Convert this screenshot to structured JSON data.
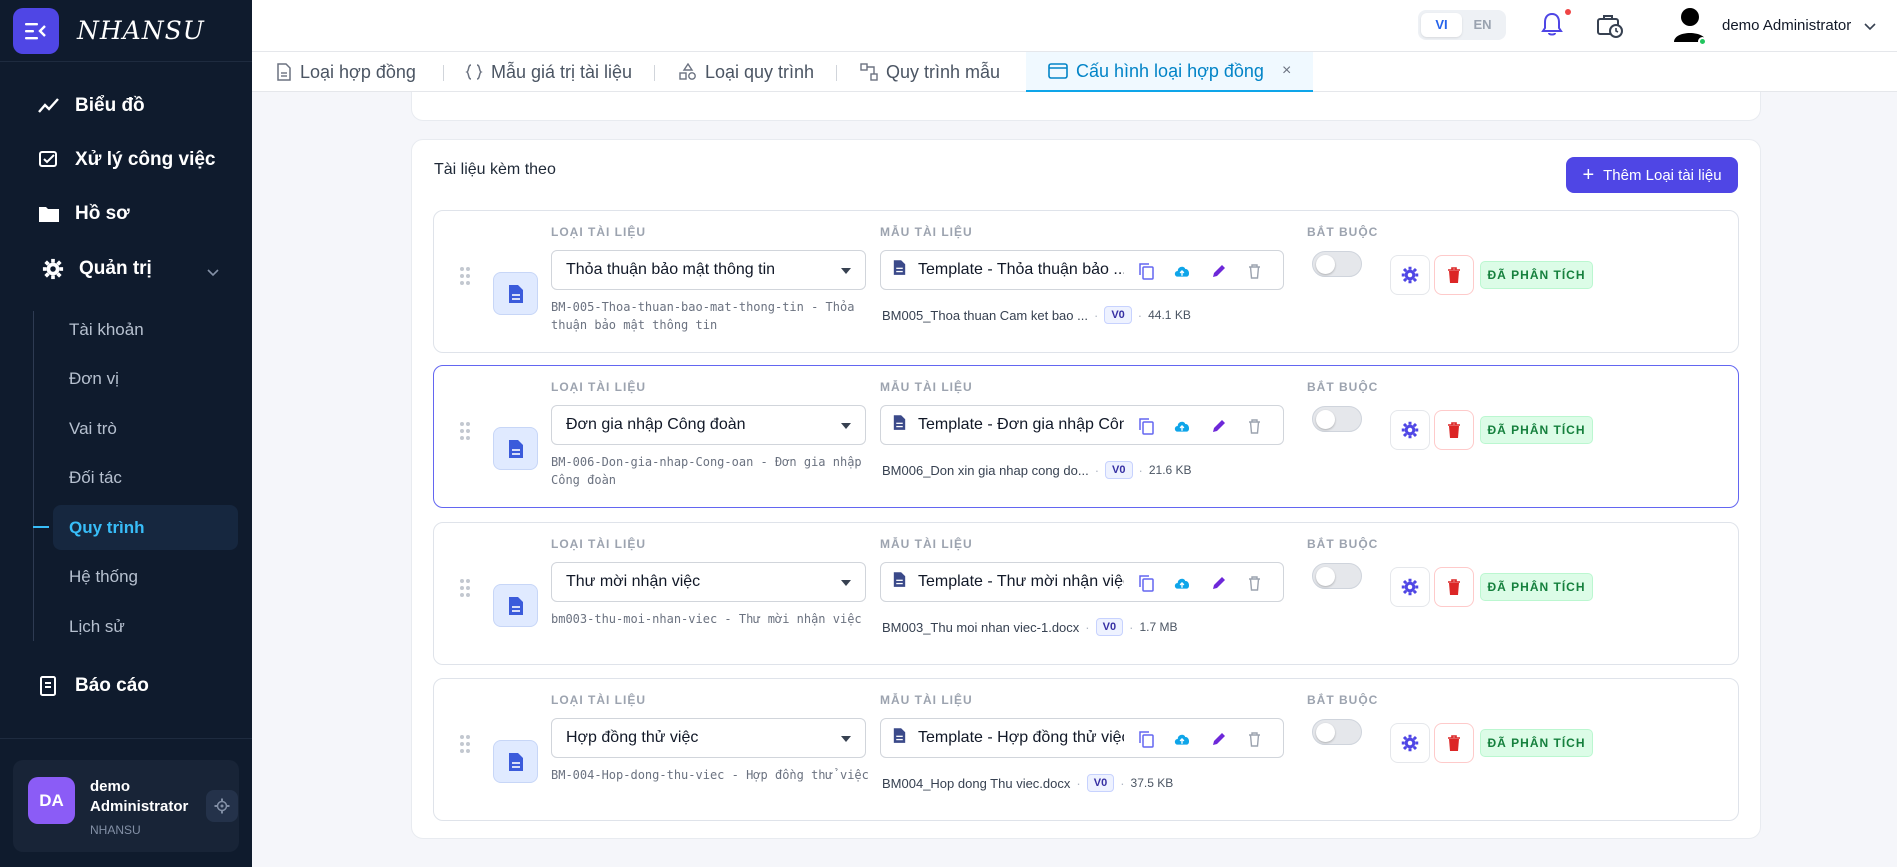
{
  "app": {
    "brand": "NHANSU"
  },
  "sidebar": {
    "items": [
      {
        "label": "Biểu đồ",
        "icon": "chart-line-icon"
      },
      {
        "label": "Xử lý công việc",
        "icon": "task-icon"
      },
      {
        "label": "Hồ sơ",
        "icon": "folder-icon"
      },
      {
        "label": "Quản trị",
        "icon": "gear-icon"
      },
      {
        "label": "Báo cáo",
        "icon": "report-icon"
      }
    ],
    "sub_items": [
      {
        "label": "Tài khoản"
      },
      {
        "label": "Đơn vị"
      },
      {
        "label": "Vai trò"
      },
      {
        "label": "Đối tác"
      },
      {
        "label": "Quy trình",
        "active": true
      },
      {
        "label": "Hệ thống"
      },
      {
        "label": "Lịch sử"
      }
    ],
    "user": {
      "initials": "DA",
      "name": "demo Administrator",
      "org": "NHANSU"
    }
  },
  "topbar": {
    "lang": {
      "vi": "VI",
      "en": "EN",
      "active": "VI"
    },
    "user_name": "demo Administrator"
  },
  "tabs": [
    {
      "label": "Loại hợp đồng"
    },
    {
      "label": "Mẫu giá trị tài liệu"
    },
    {
      "label": "Loại quy trình"
    },
    {
      "label": "Quy trình mẫu"
    },
    {
      "label": "Cấu hình loại hợp đồng",
      "active": true,
      "close": "×"
    }
  ],
  "section": {
    "title": "Tài liệu kèm theo",
    "add_button": "Thêm Loại tài liệu",
    "col_doc_type": "LOẠI TÀI LIỆU",
    "col_template": "MẪU TÀI LIỆU",
    "col_required": "BẮT BUỘC"
  },
  "rows": [
    {
      "doc_type": "Thỏa thuận bảo mật thông tin",
      "code": "BM-005-Thoa-thuan-bao-mat-thong-tin - Thỏa thuận bảo mật thông tin",
      "template": "Template - Thỏa thuận bảo ...",
      "file": "BM005_Thoa thuan Cam ket bao ...",
      "version": "V0",
      "size": "44.1 KB",
      "required": false,
      "status": "ĐÃ PHÂN TÍCH"
    },
    {
      "doc_type": "Đơn gia nhập Công đoàn",
      "code": "BM-006-Don-gia-nhap-Cong-oan - Đơn gia nhập Công đoàn",
      "template": "Template - Đơn gia nhập Côn...",
      "file": "BM006_Don xin gia nhap cong do...",
      "version": "V0",
      "size": "21.6 KB",
      "required": false,
      "status": "ĐÃ PHÂN TÍCH",
      "selected": true
    },
    {
      "doc_type": "Thư mời nhận việc",
      "code": "bm003-thu-moi-nhan-viec - Thư mời nhận việc",
      "template": "Template - Thư mời nhận việc",
      "file": "BM003_Thu moi nhan viec-1.docx",
      "version": "V0",
      "size": "1.7 MB",
      "required": false,
      "status": "ĐÃ PHÂN TÍCH"
    },
    {
      "doc_type": "Hợp đồng thử việc",
      "code": "BM-004-Hop-dong-thu-viec - Hợp đồng thử việc",
      "template": "Template - Hợp đồng thử việc",
      "file": "BM004_Hop dong Thu viec.docx",
      "version": "V0",
      "size": "37.5 KB",
      "required": false,
      "status": "ĐÃ PHÂN TÍCH"
    }
  ],
  "colors": {
    "accent": "#4f46e5",
    "sidebar_bg": "#0f1b2d",
    "active_tab": "#0284c7",
    "success": "#15803d",
    "danger": "#ef4444"
  }
}
